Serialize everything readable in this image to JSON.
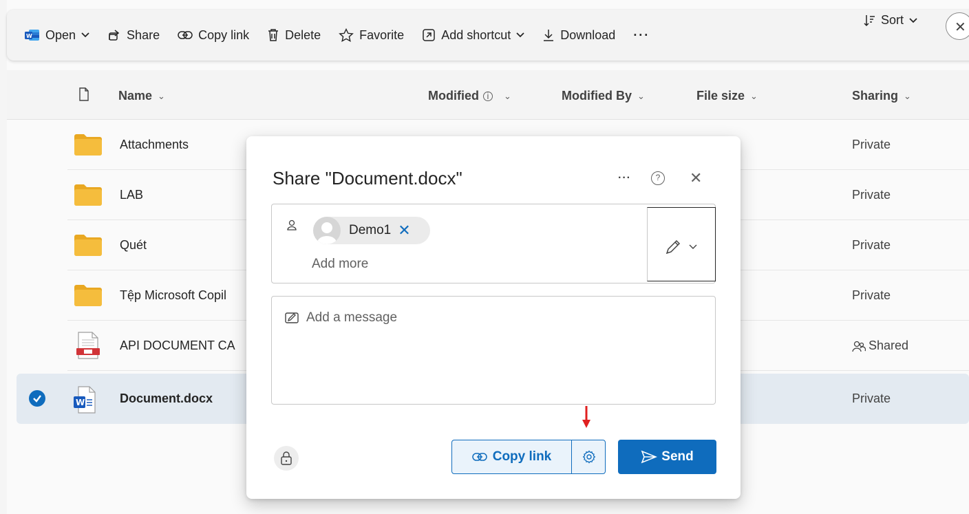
{
  "toolbar": {
    "open_label": "Open",
    "share_label": "Share",
    "copy_link_label": "Copy link",
    "delete_label": "Delete",
    "favorite_label": "Favorite",
    "add_shortcut_label": "Add shortcut",
    "download_label": "Download",
    "more_label": "···",
    "sort_label": "Sort"
  },
  "list": {
    "headers": {
      "name": "Name",
      "modified": "Modified",
      "modified_by": "Modified By",
      "file_size": "File size",
      "sharing": "Sharing"
    },
    "rows": [
      {
        "name": "Attachments",
        "sharing": "Private",
        "type": "folder"
      },
      {
        "name": "LAB",
        "sharing": "Private",
        "type": "folder"
      },
      {
        "name": "Quét",
        "sharing": "Private",
        "type": "folder"
      },
      {
        "name": "Tệp Microsoft Copil",
        "sharing": "Private",
        "type": "folder"
      },
      {
        "name": "API DOCUMENT CA",
        "sharing": "Shared",
        "type": "pdf"
      },
      {
        "name": "Document.docx",
        "sharing": "Private",
        "type": "word",
        "selected": true
      }
    ]
  },
  "dialog": {
    "title": "Share \"Document.docx\"",
    "recipient": "Demo1",
    "add_more_placeholder": "Add more",
    "message_placeholder": "Add a message",
    "copy_link_label": "Copy link",
    "send_label": "Send"
  },
  "colors": {
    "accent": "#0f6cbd",
    "annotation_arrow": "#e02020",
    "folder": "#f2b632"
  }
}
